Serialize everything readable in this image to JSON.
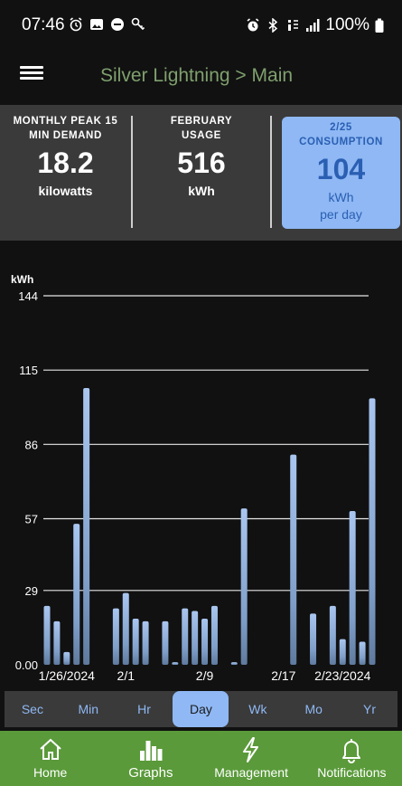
{
  "status_bar": {
    "time": "07:46",
    "battery": "100%",
    "left_icons": [
      "alarm-icon",
      "gallery-icon",
      "app-badge-icon",
      "key-icon"
    ],
    "right_icons": [
      "alarm-icon",
      "bluetooth-icon",
      "wifi-calling-icon",
      "signal-icon",
      "battery-icon"
    ]
  },
  "app_bar": {
    "title": "Silver Lightning > Main",
    "title_color": "#7fa06e"
  },
  "stats": [
    {
      "label": "MONTHLY PEAK 15\nMIN DEMAND",
      "value": "18.2",
      "unit": "kilowatts"
    },
    {
      "label": "FEBRUARY\nUSAGE",
      "value": "516",
      "unit": "kWh"
    },
    {
      "label": "2/25\nCONSUMPTION",
      "value": "104",
      "unit": "kWh\nper day",
      "highlight_color": "#8fb8f4"
    }
  ],
  "chart_data": {
    "type": "bar",
    "ylabel": "kWh",
    "ylim": [
      0,
      144
    ],
    "yticks": [
      "0.00",
      "29",
      "57",
      "86",
      "115",
      "144"
    ],
    "ytick_values": [
      0,
      29,
      57,
      86,
      115,
      144
    ],
    "xtick_labels": [
      {
        "label": "1/26/2024",
        "index": 2
      },
      {
        "label": "2/1",
        "index": 8
      },
      {
        "label": "2/9",
        "index": 16
      },
      {
        "label": "2/17",
        "index": 24
      },
      {
        "label": "2/23/2024",
        "index": 30
      }
    ],
    "grid": true,
    "bar_color": "#8fb8f4",
    "values": [
      23,
      17,
      5,
      55,
      108,
      0,
      0,
      22,
      28,
      18,
      17,
      0,
      17,
      1,
      22,
      21,
      18,
      23,
      0,
      1,
      61,
      0,
      0,
      0,
      0,
      82,
      0,
      20,
      0,
      23,
      10,
      60,
      9,
      104
    ]
  },
  "range_tabs": [
    "Sec",
    "Min",
    "Hr",
    "Day",
    "Wk",
    "Mo",
    "Yr"
  ],
  "active_range": "Day",
  "bottom_nav": [
    {
      "label": "Home",
      "icon": "home-icon"
    },
    {
      "label": "Graphs",
      "icon": "bar-chart-icon",
      "active": true
    },
    {
      "label": "Management",
      "icon": "lightning-icon"
    },
    {
      "label": "Notifications",
      "icon": "bell-icon"
    }
  ]
}
